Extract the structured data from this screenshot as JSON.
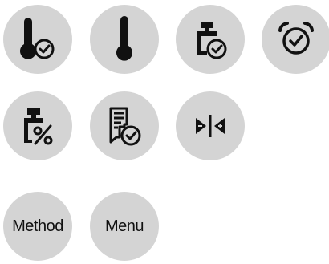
{
  "colors": {
    "button_background": "#d4d4d4",
    "icon": "#111111",
    "page_background": "#ffffff"
  },
  "buttons": [
    {
      "icon": "thermometer-timer-icon"
    },
    {
      "icon": "thermometer-icon"
    },
    {
      "icon": "weight-timer-icon"
    },
    {
      "icon": "stopwatch-icon"
    },
    {
      "icon": "weight-percent-icon"
    },
    {
      "icon": "report-timer-icon"
    },
    {
      "icon": "tare-zero-icon"
    },
    {
      "label": "Method"
    },
    {
      "label": "Menu"
    }
  ]
}
